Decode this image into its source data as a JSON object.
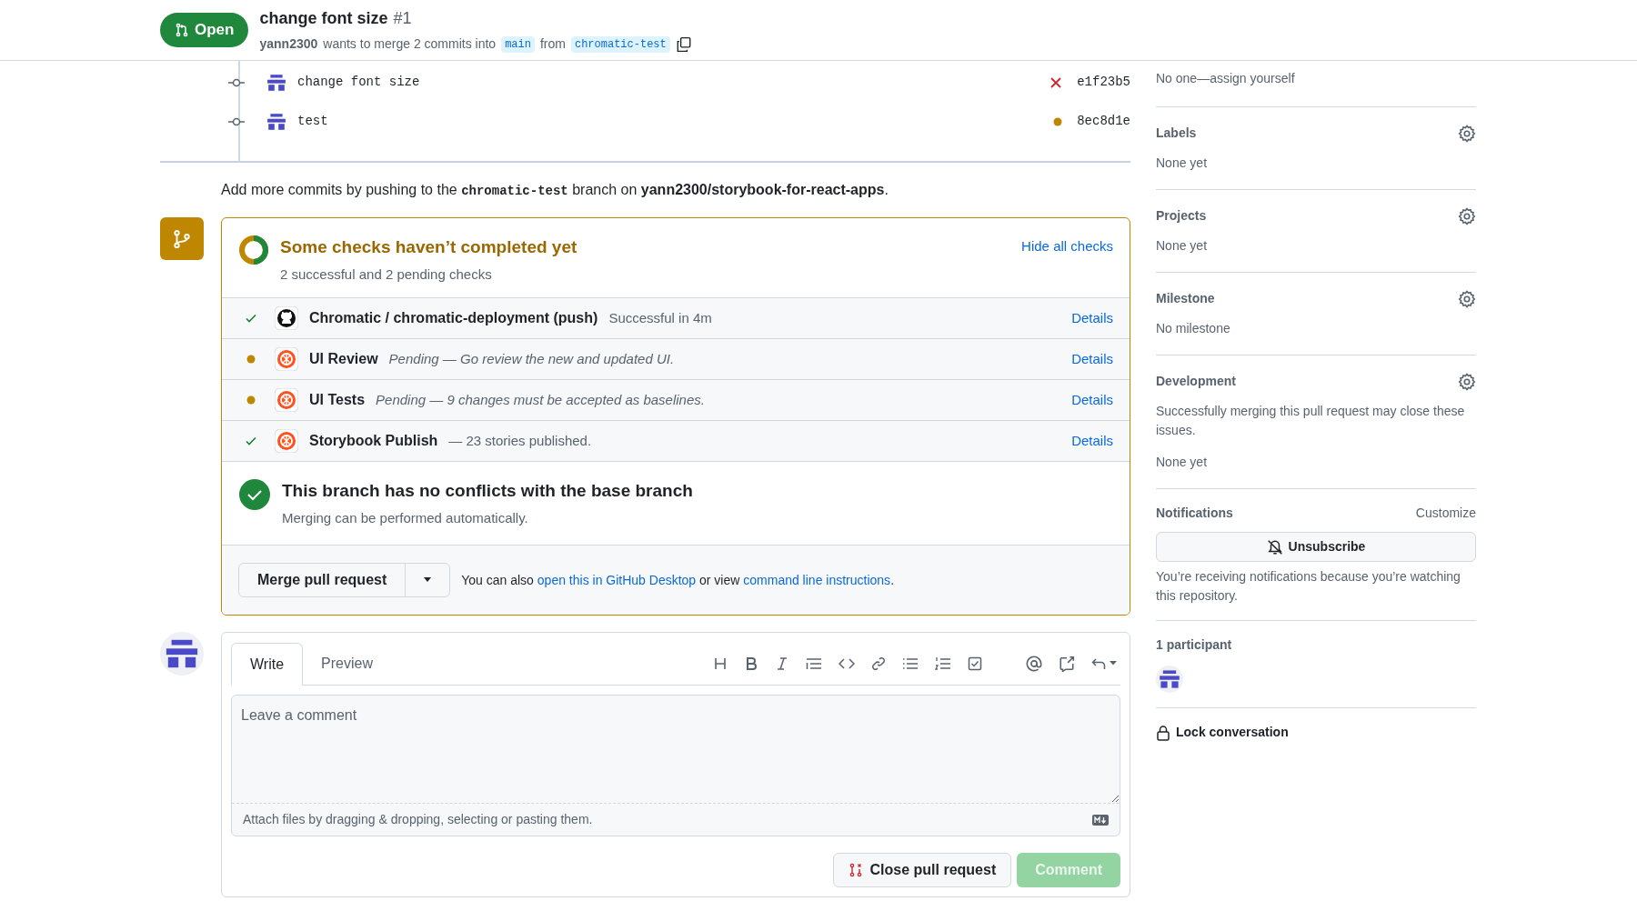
{
  "header": {
    "state": "Open",
    "title": "change font size",
    "number": "#1",
    "author": "yann2300",
    "merge_text": "wants to merge 2 commits into",
    "base": "main",
    "from_text": "from",
    "head": "chromatic-test"
  },
  "commits": [
    {
      "message": "change font size",
      "sha": "e1f23b5",
      "failed": true
    },
    {
      "message": "test",
      "sha": "8ec8d1e",
      "failed": false
    }
  ],
  "push_hint": {
    "before": "Add more commits by pushing to the",
    "branch": "chromatic-test",
    "middle": "branch on",
    "repo": "yann2300/storybook-for-react-apps",
    "after": "."
  },
  "checks": {
    "title": "Some checks haven’t completed yet",
    "summary": "2 successful and 2 pending checks",
    "toggle": "Hide all checks",
    "items": [
      {
        "completed": true,
        "kind": "github",
        "name": "Chromatic / chromatic-deployment (push)",
        "description": "Successful in 4m",
        "action": "Details"
      },
      {
        "completed": false,
        "kind": "chromatic",
        "name": "UI Review",
        "description": "Pending — Go review the new and updated UI.",
        "action": "Details"
      },
      {
        "completed": false,
        "kind": "chromatic",
        "name": "UI Tests",
        "description": "Pending — 9 changes must be accepted as baselines.",
        "action": "Details"
      },
      {
        "completed": true,
        "kind": "chromatic",
        "name": "Storybook Publish",
        "description": "— 23 stories published.",
        "action": "Details"
      }
    ]
  },
  "conflicts": {
    "title": "This branch has no conflicts with the base branch",
    "subtitle": "Merging can be performed automatically."
  },
  "merge": {
    "button": "Merge pull request",
    "hint_before": "You can also",
    "link1": "open this in GitHub Desktop",
    "hint_middle": "or view",
    "link2": "command line instructions",
    "hint_after": "."
  },
  "composer": {
    "tabs": [
      {
        "label": "Write",
        "selected": true
      },
      {
        "label": "Preview",
        "selected": false
      }
    ],
    "placeholder": "Leave a comment",
    "attach_hint": "Attach files by dragging & dropping, selecting or pasting them.",
    "close_button": "Close pull request",
    "comment_button": "Comment",
    "comment_disabled": true
  },
  "sidebar": {
    "assignees_text": "No one—assign yourself",
    "sections": [
      {
        "heading": "Labels",
        "gear": true,
        "texts": [
          "None yet"
        ]
      },
      {
        "heading": "Projects",
        "gear": true,
        "texts": [
          "None yet"
        ]
      },
      {
        "heading": "Milestone",
        "gear": true,
        "texts": [
          "No milestone"
        ]
      },
      {
        "heading": "Development",
        "gear": true,
        "texts": [
          "Successfully merging this pull request may close these issues.",
          "None yet"
        ]
      }
    ],
    "notifications": {
      "heading": "Notifications",
      "customize": "Customize",
      "button": "Unsubscribe",
      "note": "You’re receiving notifications because you’re watching this repository."
    },
    "participants": {
      "heading": "1 participant"
    },
    "lock": "Lock conversation"
  }
}
